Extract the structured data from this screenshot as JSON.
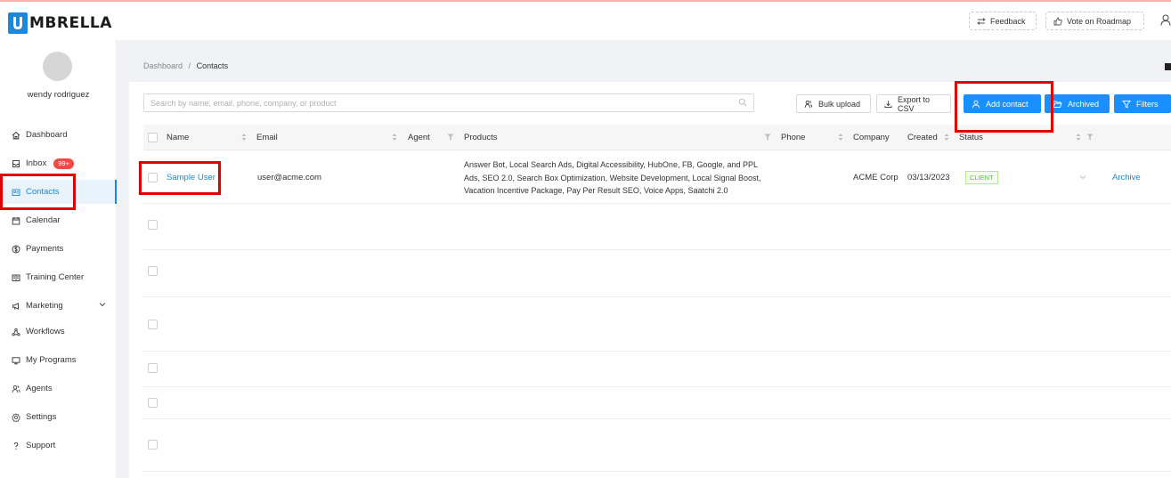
{
  "header": {
    "brand_letter": "U",
    "brand_rest": "MBRELLA",
    "feedback_label": "Feedback",
    "roadmap_label": "Vote on Roadmap"
  },
  "sidebar": {
    "user_name": "wendy rodriguez",
    "inbox_badge": "99+",
    "items": [
      {
        "label": "Dashboard",
        "icon": "home-icon"
      },
      {
        "label": "Inbox",
        "icon": "inbox-icon"
      },
      {
        "label": "Contacts",
        "icon": "contacts-icon"
      },
      {
        "label": "Calendar",
        "icon": "calendar-icon"
      },
      {
        "label": "Payments",
        "icon": "dollar-icon"
      },
      {
        "label": "Training Center",
        "icon": "book-icon"
      },
      {
        "label": "Marketing",
        "icon": "megaphone-icon"
      },
      {
        "label": "Workflows",
        "icon": "workflow-icon"
      },
      {
        "label": "My Programs",
        "icon": "monitor-icon"
      },
      {
        "label": "Agents",
        "icon": "agents-icon"
      },
      {
        "label": "Settings",
        "icon": "gear-icon"
      },
      {
        "label": "Support",
        "icon": "question-icon"
      }
    ]
  },
  "breadcrumb": {
    "root": "Dashboard",
    "separator": "/",
    "current": "Contacts"
  },
  "toolbar": {
    "search_placeholder": "Search by name, email, phone, company, or product",
    "bulk_upload": "Bulk upload",
    "export_csv": "Export to CSV",
    "add_contact": "Add contact",
    "archived": "Archived",
    "filters": "Filters"
  },
  "table": {
    "columns": [
      "Name",
      "Email",
      "Agent",
      "Products",
      "Phone",
      "Company",
      "Created",
      "Status"
    ],
    "rows": [
      {
        "name": "Sample User",
        "email": "user@acme.com",
        "agent": "",
        "products": "Answer Bot, Local Search Ads, Digital Accessibility, HubOne, FB, Google, and PPL Ads, SEO 2.0, Search Box Optimization, Website Development, Local Signal Boost, Vacation Incentive Package, Pay Per Result SEO, Voice Apps, Saatchi 2.0",
        "phone": "",
        "company": "ACME Corp",
        "created": "03/13/2023",
        "status": "CLIENT",
        "action": "Archive"
      }
    ]
  },
  "colors": {
    "accent": "#1890ff",
    "brand": "#1e88d8",
    "highlight_box": "#e00000",
    "badge": "#f04a46"
  }
}
